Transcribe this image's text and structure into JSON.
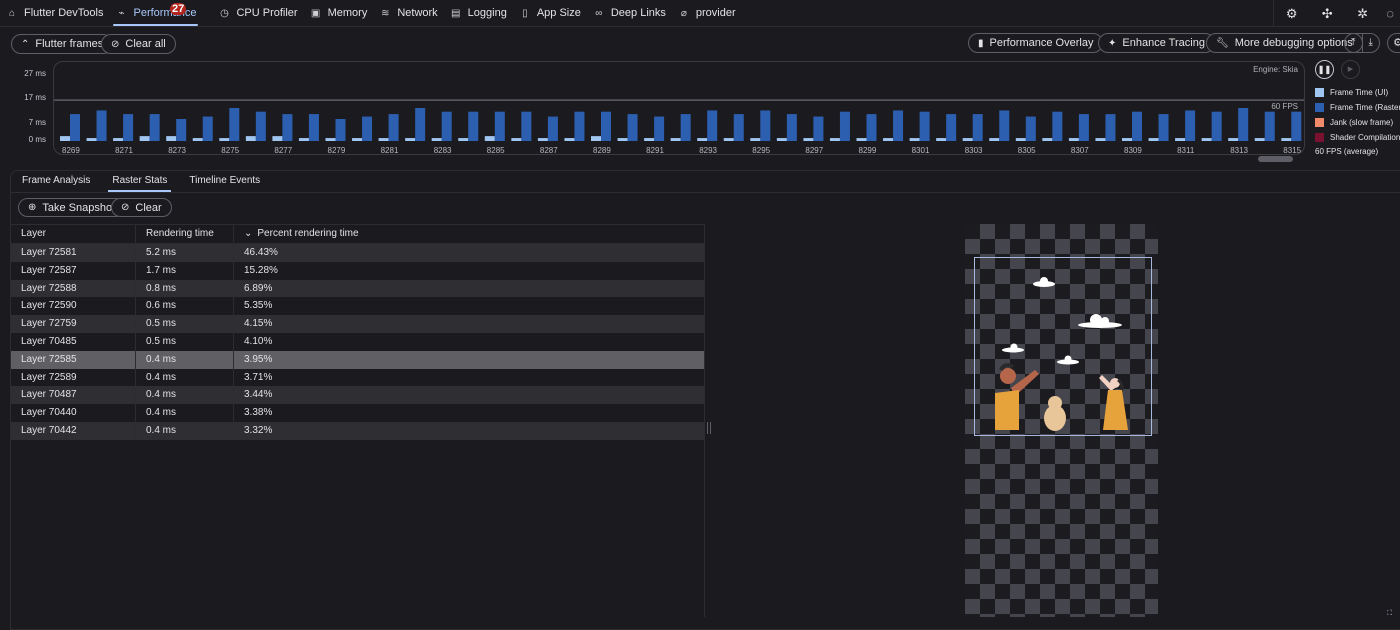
{
  "nav": {
    "tabs": [
      {
        "label": "Flutter DevTools",
        "icon": "home-icon",
        "glyph": "⌂"
      },
      {
        "label": "Performance",
        "icon": "performance-icon",
        "glyph": "⌁",
        "active": true
      },
      {
        "label": "CPU Profiler",
        "icon": "timer-icon",
        "glyph": "◷"
      },
      {
        "label": "Memory",
        "icon": "memory-icon",
        "glyph": "▣"
      },
      {
        "label": "Network",
        "icon": "wifi-icon",
        "glyph": "≋"
      },
      {
        "label": "Logging",
        "icon": "clipboard-icon",
        "glyph": "▤"
      },
      {
        "label": "App Size",
        "icon": "document-icon",
        "glyph": "▯"
      },
      {
        "label": "Deep Links",
        "icon": "link-icon",
        "glyph": "∞"
      },
      {
        "label": "provider",
        "icon": "paperclip-icon",
        "glyph": "⌀"
      }
    ],
    "badge": "27",
    "right_icons": [
      {
        "name": "settings-icon",
        "glyph": "⚙"
      },
      {
        "name": "extensions-icon",
        "glyph": "✣"
      },
      {
        "name": "bug-icon",
        "glyph": "✲"
      }
    ]
  },
  "toolbar": {
    "flutter_frames": "Flutter frames",
    "clear_all": "Clear all",
    "performance_overlay": "Performance Overlay",
    "enhance_tracing": "Enhance Tracing",
    "more_debugging": "More debugging options"
  },
  "chart_data": {
    "type": "bar",
    "title": "Flutter frames",
    "engine_label": "Engine: Skia",
    "target_line_label": "60 FPS",
    "ylabel": "ms",
    "yticks": [
      "27 ms",
      "17 ms",
      "7 ms",
      "0 ms"
    ],
    "ytick_values": [
      27,
      17,
      7,
      0
    ],
    "ylim": [
      0,
      27
    ],
    "target_ms": 16.7,
    "x": [
      8269,
      8270,
      8271,
      8272,
      8273,
      8274,
      8275,
      8276,
      8277,
      8278,
      8279,
      8280,
      8281,
      8282,
      8283,
      8284,
      8285,
      8286,
      8287,
      8288,
      8289,
      8290,
      8291,
      8292,
      8293,
      8294,
      8295,
      8296,
      8297,
      8298,
      8299,
      8300,
      8301,
      8302,
      8303,
      8304,
      8305,
      8306,
      8307,
      8308,
      8309,
      8310,
      8311,
      8312,
      8313,
      8314,
      8315
    ],
    "xtick_labels": [
      "8269",
      "8271",
      "8273",
      "8275",
      "8277",
      "8279",
      "8281",
      "8283",
      "8285",
      "8287",
      "8289",
      "8291",
      "8293",
      "8295",
      "8297",
      "8299",
      "8301",
      "8303",
      "8305",
      "8307",
      "8309",
      "8311",
      "8313",
      "8315"
    ],
    "series": [
      {
        "name": "Frame Time (UI)",
        "color": "#9fc5f0",
        "values": [
          2.0,
          1.2,
          1.2,
          2.0,
          2.0,
          1.2,
          1.2,
          2.0,
          2.0,
          1.2,
          1.2,
          1.2,
          1.2,
          1.2,
          1.2,
          1.2,
          2.0,
          1.2,
          1.2,
          1.2,
          2.0,
          1.2,
          1.2,
          1.2,
          1.2,
          1.2,
          1.2,
          1.2,
          1.2,
          1.2,
          1.2,
          1.2,
          1.2,
          1.2,
          1.2,
          1.2,
          1.2,
          1.2,
          1.2,
          1.2,
          1.2,
          1.2,
          1.2,
          1.2,
          1.2,
          1.2,
          1.2
        ]
      },
      {
        "name": "Frame Time (Raster)",
        "color": "#2d5fb0",
        "values": [
          11.0,
          12.5,
          11.0,
          11.0,
          9.0,
          10.0,
          13.5,
          12.0,
          11.0,
          11.0,
          9.0,
          10.0,
          11.0,
          13.5,
          12.0,
          12.0,
          12.0,
          12.0,
          10.0,
          12.0,
          12.0,
          11.0,
          10.0,
          11.0,
          12.5,
          11.0,
          12.5,
          11.0,
          10.0,
          12.0,
          11.0,
          12.5,
          12.0,
          11.0,
          11.0,
          12.5,
          10.0,
          12.0,
          11.0,
          11.0,
          12.0,
          11.0,
          12.5,
          12.0,
          13.5,
          12.0,
          12.0
        ]
      }
    ],
    "legend": [
      {
        "label": "Frame Time (UI)",
        "color": "#9fc5f0"
      },
      {
        "label": "Frame Time (Raster)",
        "color": "#2d5fb0"
      },
      {
        "label": "Jank (slow frame)",
        "color": "#f28b6c"
      },
      {
        "label": "Shader Compilation",
        "color": "#7a1130"
      }
    ],
    "legend_position": "right",
    "average_fps": "60 FPS (average)"
  },
  "subtabs": [
    "Frame Analysis",
    "Raster Stats",
    "Timeline Events"
  ],
  "raster": {
    "take_snapshot": "Take Snapshot",
    "clear": "Clear",
    "columns": [
      "Layer",
      "Rendering time",
      "Percent rendering time"
    ],
    "sort_indicator": "⌄",
    "rows": [
      {
        "layer": "Layer 72581",
        "time": "5.2 ms",
        "percent": "46.43%"
      },
      {
        "layer": "Layer 72587",
        "time": "1.7 ms",
        "percent": "15.28%"
      },
      {
        "layer": "Layer 72588",
        "time": "0.8 ms",
        "percent": "6.89%"
      },
      {
        "layer": "Layer 72590",
        "time": "0.6 ms",
        "percent": "5.35%"
      },
      {
        "layer": "Layer 72759",
        "time": "0.5 ms",
        "percent": "4.15%"
      },
      {
        "layer": "Layer 70485",
        "time": "0.5 ms",
        "percent": "4.10%"
      },
      {
        "layer": "Layer 72585",
        "time": "0.4 ms",
        "percent": "3.95%",
        "selected": true
      },
      {
        "layer": "Layer 72589",
        "time": "0.4 ms",
        "percent": "3.71%"
      },
      {
        "layer": "Layer 70487",
        "time": "0.4 ms",
        "percent": "3.44%"
      },
      {
        "layer": "Layer 70440",
        "time": "0.4 ms",
        "percent": "3.38%"
      },
      {
        "layer": "Layer 70442",
        "time": "0.4 ms",
        "percent": "3.32%"
      }
    ]
  }
}
